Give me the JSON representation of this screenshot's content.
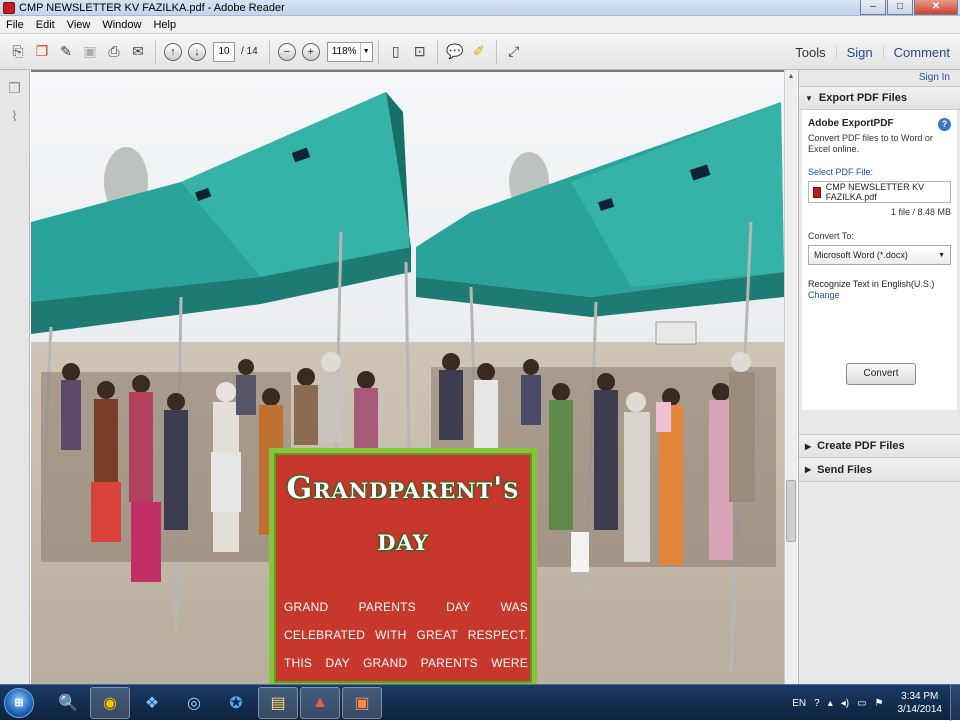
{
  "window": {
    "title": "CMP NEWSLETTER KV FAZILKA.pdf - Adobe Reader",
    "controls": [
      "–",
      "□",
      "✕"
    ]
  },
  "menu": [
    "File",
    "Edit",
    "View",
    "Window",
    "Help"
  ],
  "toolbar": {
    "current_page": "10",
    "total_pages": "/ 14",
    "zoom": "118%",
    "right_tabs": [
      "Tools",
      "Sign",
      "Comment"
    ]
  },
  "document": {
    "card_title_line1": "Grandparent's",
    "card_title_line2": "day",
    "card_text": "GRAND PARENTS DAY WAS CELEBRATED WITH GREAT RESPECT. THIS DAY GRAND PARENTS WERE HONOURED BY THE STUDENTS. GRAND PARENTS SHARED THIER"
  },
  "right_pane": {
    "sign_in": "Sign In",
    "export_header": "Export PDF Files",
    "adobe_export": "Adobe ExportPDF",
    "description": "Convert PDF files to to Word or Excel online.",
    "select_label": "Select PDF File:",
    "file_name": "CMP NEWSLETTER KV FAZILKA.pdf",
    "file_meta": "1 file / 8.48 MB",
    "convert_to_label": "Convert To:",
    "convert_format": "Microsoft Word (*.docx)",
    "recognize_text": "Recognize Text in English(U.S.)",
    "change_link": "Change",
    "convert_button": "Convert",
    "create_header": "Create PDF Files",
    "send_header": "Send Files"
  },
  "taskbar": {
    "language": "EN",
    "time": "3:34 PM",
    "date": "3/14/2014"
  },
  "colors": {
    "card_red": "#c8372b",
    "card_border": "#86c53a",
    "tent": "#2aa39a"
  }
}
